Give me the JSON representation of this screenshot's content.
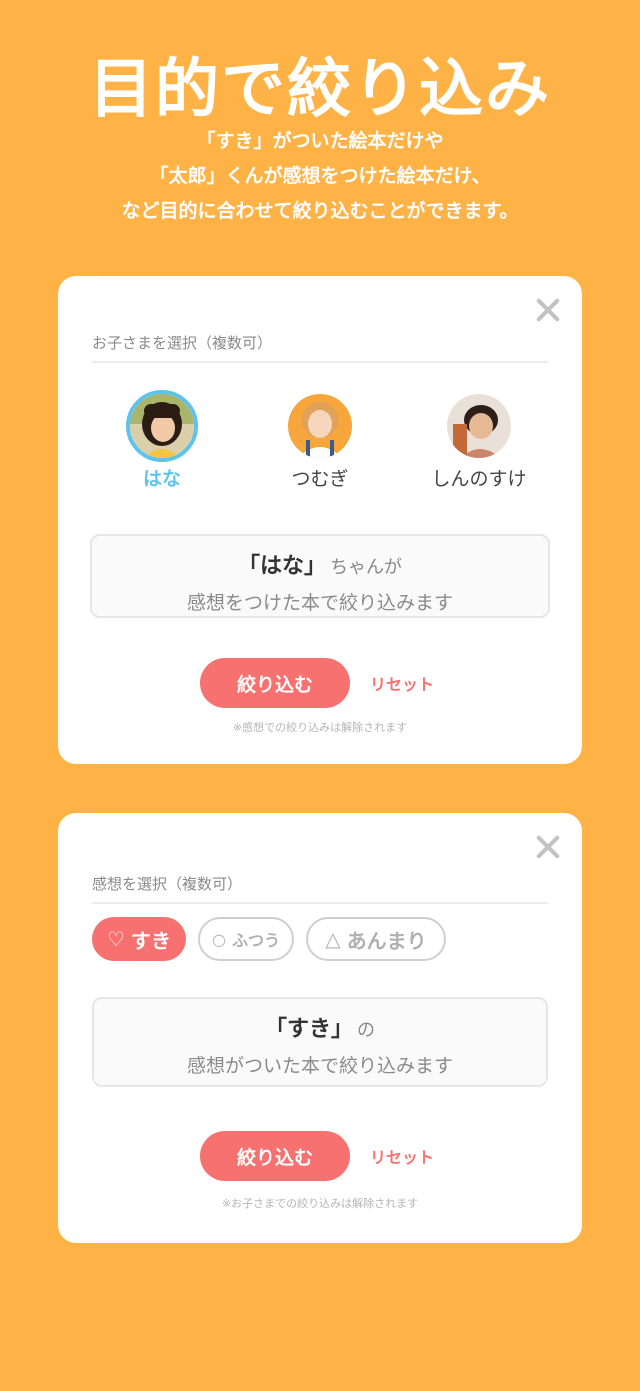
{
  "hero": {
    "title": "目的で絞り込み",
    "lines": [
      "「すき」がついた絵本だけや",
      "「太郎」くんが感想をつけた絵本だけ、",
      "など目的に合わせて絞り込むことができます。"
    ]
  },
  "colors": {
    "background": "#FFB347",
    "accent": "#F6716F",
    "selected": "#5EC3EC"
  },
  "kids_card": {
    "label": "お子さまを選択（複数可）",
    "children": [
      {
        "name": "はな",
        "selected": true
      },
      {
        "name": "つむぎ",
        "selected": false
      },
      {
        "name": "しんのすけ",
        "selected": false
      }
    ],
    "info_quote": "「はな」",
    "info_suffix": "ちゃんが",
    "info_line2": "感想をつけた本で絞り込みます",
    "filter_label": "絞り込む",
    "reset_label": "リセット",
    "note": "※感想での絞り込みは解除されます"
  },
  "feel_card": {
    "label": "感想を選択（複数可）",
    "chips": [
      {
        "symbol": "♡",
        "label": "すき",
        "active": true
      },
      {
        "symbol": "○",
        "label": "ふつう",
        "active": false
      },
      {
        "symbol": "△",
        "label": "あんまり",
        "active": false
      }
    ],
    "info_quote": "「すき」",
    "info_suffix": "の",
    "info_line2": "感想がついた本で絞り込みます",
    "filter_label": "絞り込む",
    "reset_label": "リセット",
    "note": "※お子さまでの絞り込みは解除されます"
  }
}
